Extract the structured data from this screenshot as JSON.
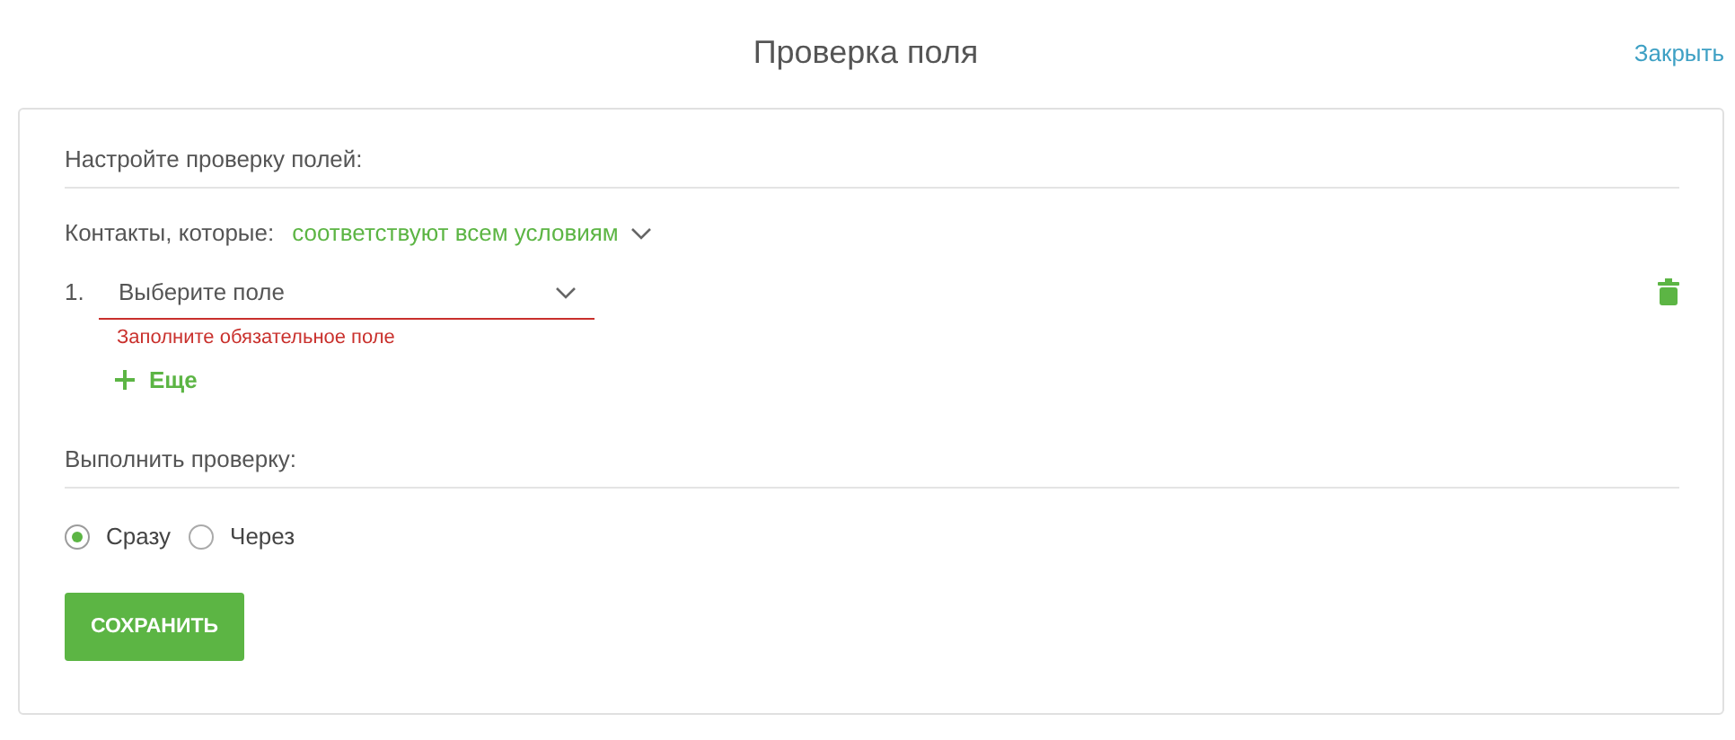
{
  "dialog": {
    "title": "Проверка поля",
    "close_link": "Закрыть"
  },
  "section_heading": "Настройте проверку полей:",
  "match": {
    "label": "Контакты, которые:",
    "value": "соответствуют всем условиям"
  },
  "conditions": [
    {
      "number": "1.",
      "placeholder": "Выберите поле",
      "invalid": true,
      "error": "Заполните обязательное поле"
    }
  ],
  "add_link": "Еще",
  "run_heading": "Выполнить проверку:",
  "timing": [
    {
      "label": "Сразу",
      "selected": true
    },
    {
      "label": "Через",
      "selected": false
    }
  ],
  "save_button": "СОХРАНИТЬ"
}
